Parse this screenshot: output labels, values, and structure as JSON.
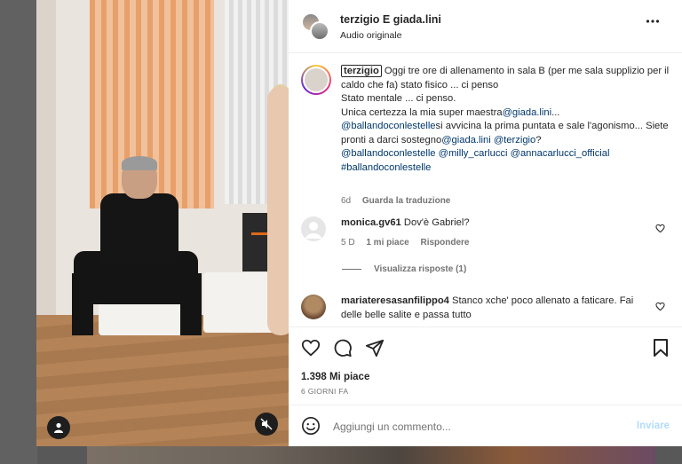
{
  "header": {
    "names": "terzigio E giada.lini",
    "audio": "Audio originale",
    "more_icon": "more-horizontal-icon"
  },
  "caption": {
    "username": "terzigio",
    "line1": "Oggi tre ore di allenamento in sala B (per me sala supplizio per il caldo che fa) stato fisico ... ci penso",
    "line2": "Stato mentale ... ci penso.",
    "line3a": "Unica certezza la mia super maestra",
    "line3tag": "@giada.lini",
    "line3b": "...",
    "line4tag": "@ballandoconlestelle",
    "line4b": "si avvicina la prima puntata e sale l'agonismo... Siete pronti a darci sostegno",
    "line4tag2": "@giada.lini",
    "line4tag3": "@terzigio",
    "line4c": "?",
    "line5": "@ballandoconlestelle @milly_carlucci @annacarlucci_official",
    "line6": "#ballandoconlestelle",
    "time": "6d",
    "translate": "Guarda la traduzione"
  },
  "comments": [
    {
      "user": "monica.gv61",
      "text": "Dov'è Gabriel?",
      "time": "5 D",
      "likes": "1 mi piace",
      "reply": "Rispondere",
      "view_replies": "Visualizza risposte (1)"
    },
    {
      "user": "mariateresasanfilippo4",
      "text": "Stanco xche' poco allenato a faticare. Fai delle belle salite e passa tutto"
    }
  ],
  "actions": {
    "likes": "1.398 Mi piace",
    "ago": "6 GIORNI FA"
  },
  "composer": {
    "placeholder": "Aggiungi un commento...",
    "send": "Inviare"
  }
}
